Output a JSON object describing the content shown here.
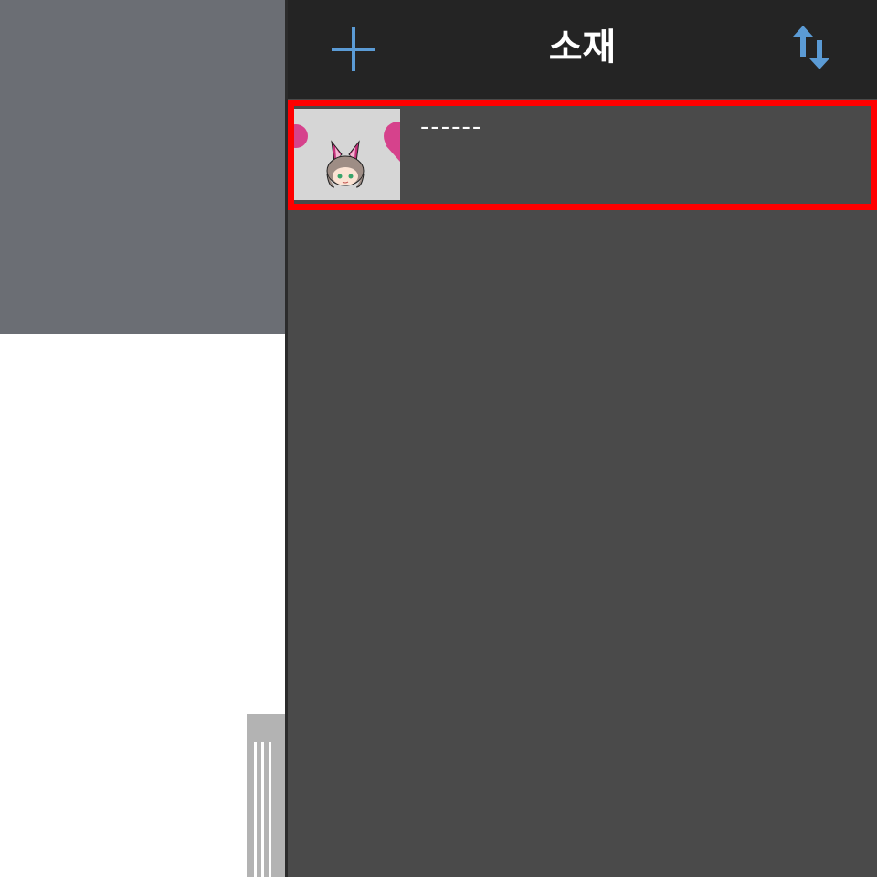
{
  "panel": {
    "title": "소재",
    "add_icon": "plus-icon",
    "sort_icon": "sort-arrows-icon",
    "accent_color": "#5b9bd5"
  },
  "materials": [
    {
      "name": "------",
      "thumbnail": "character-head-thumbnail",
      "selected": true
    }
  ],
  "colors": {
    "panel_bg": "#4a4a4a",
    "header_bg": "#242424",
    "selection_border": "#ff0000",
    "left_top_bg": "#6b6e74"
  }
}
